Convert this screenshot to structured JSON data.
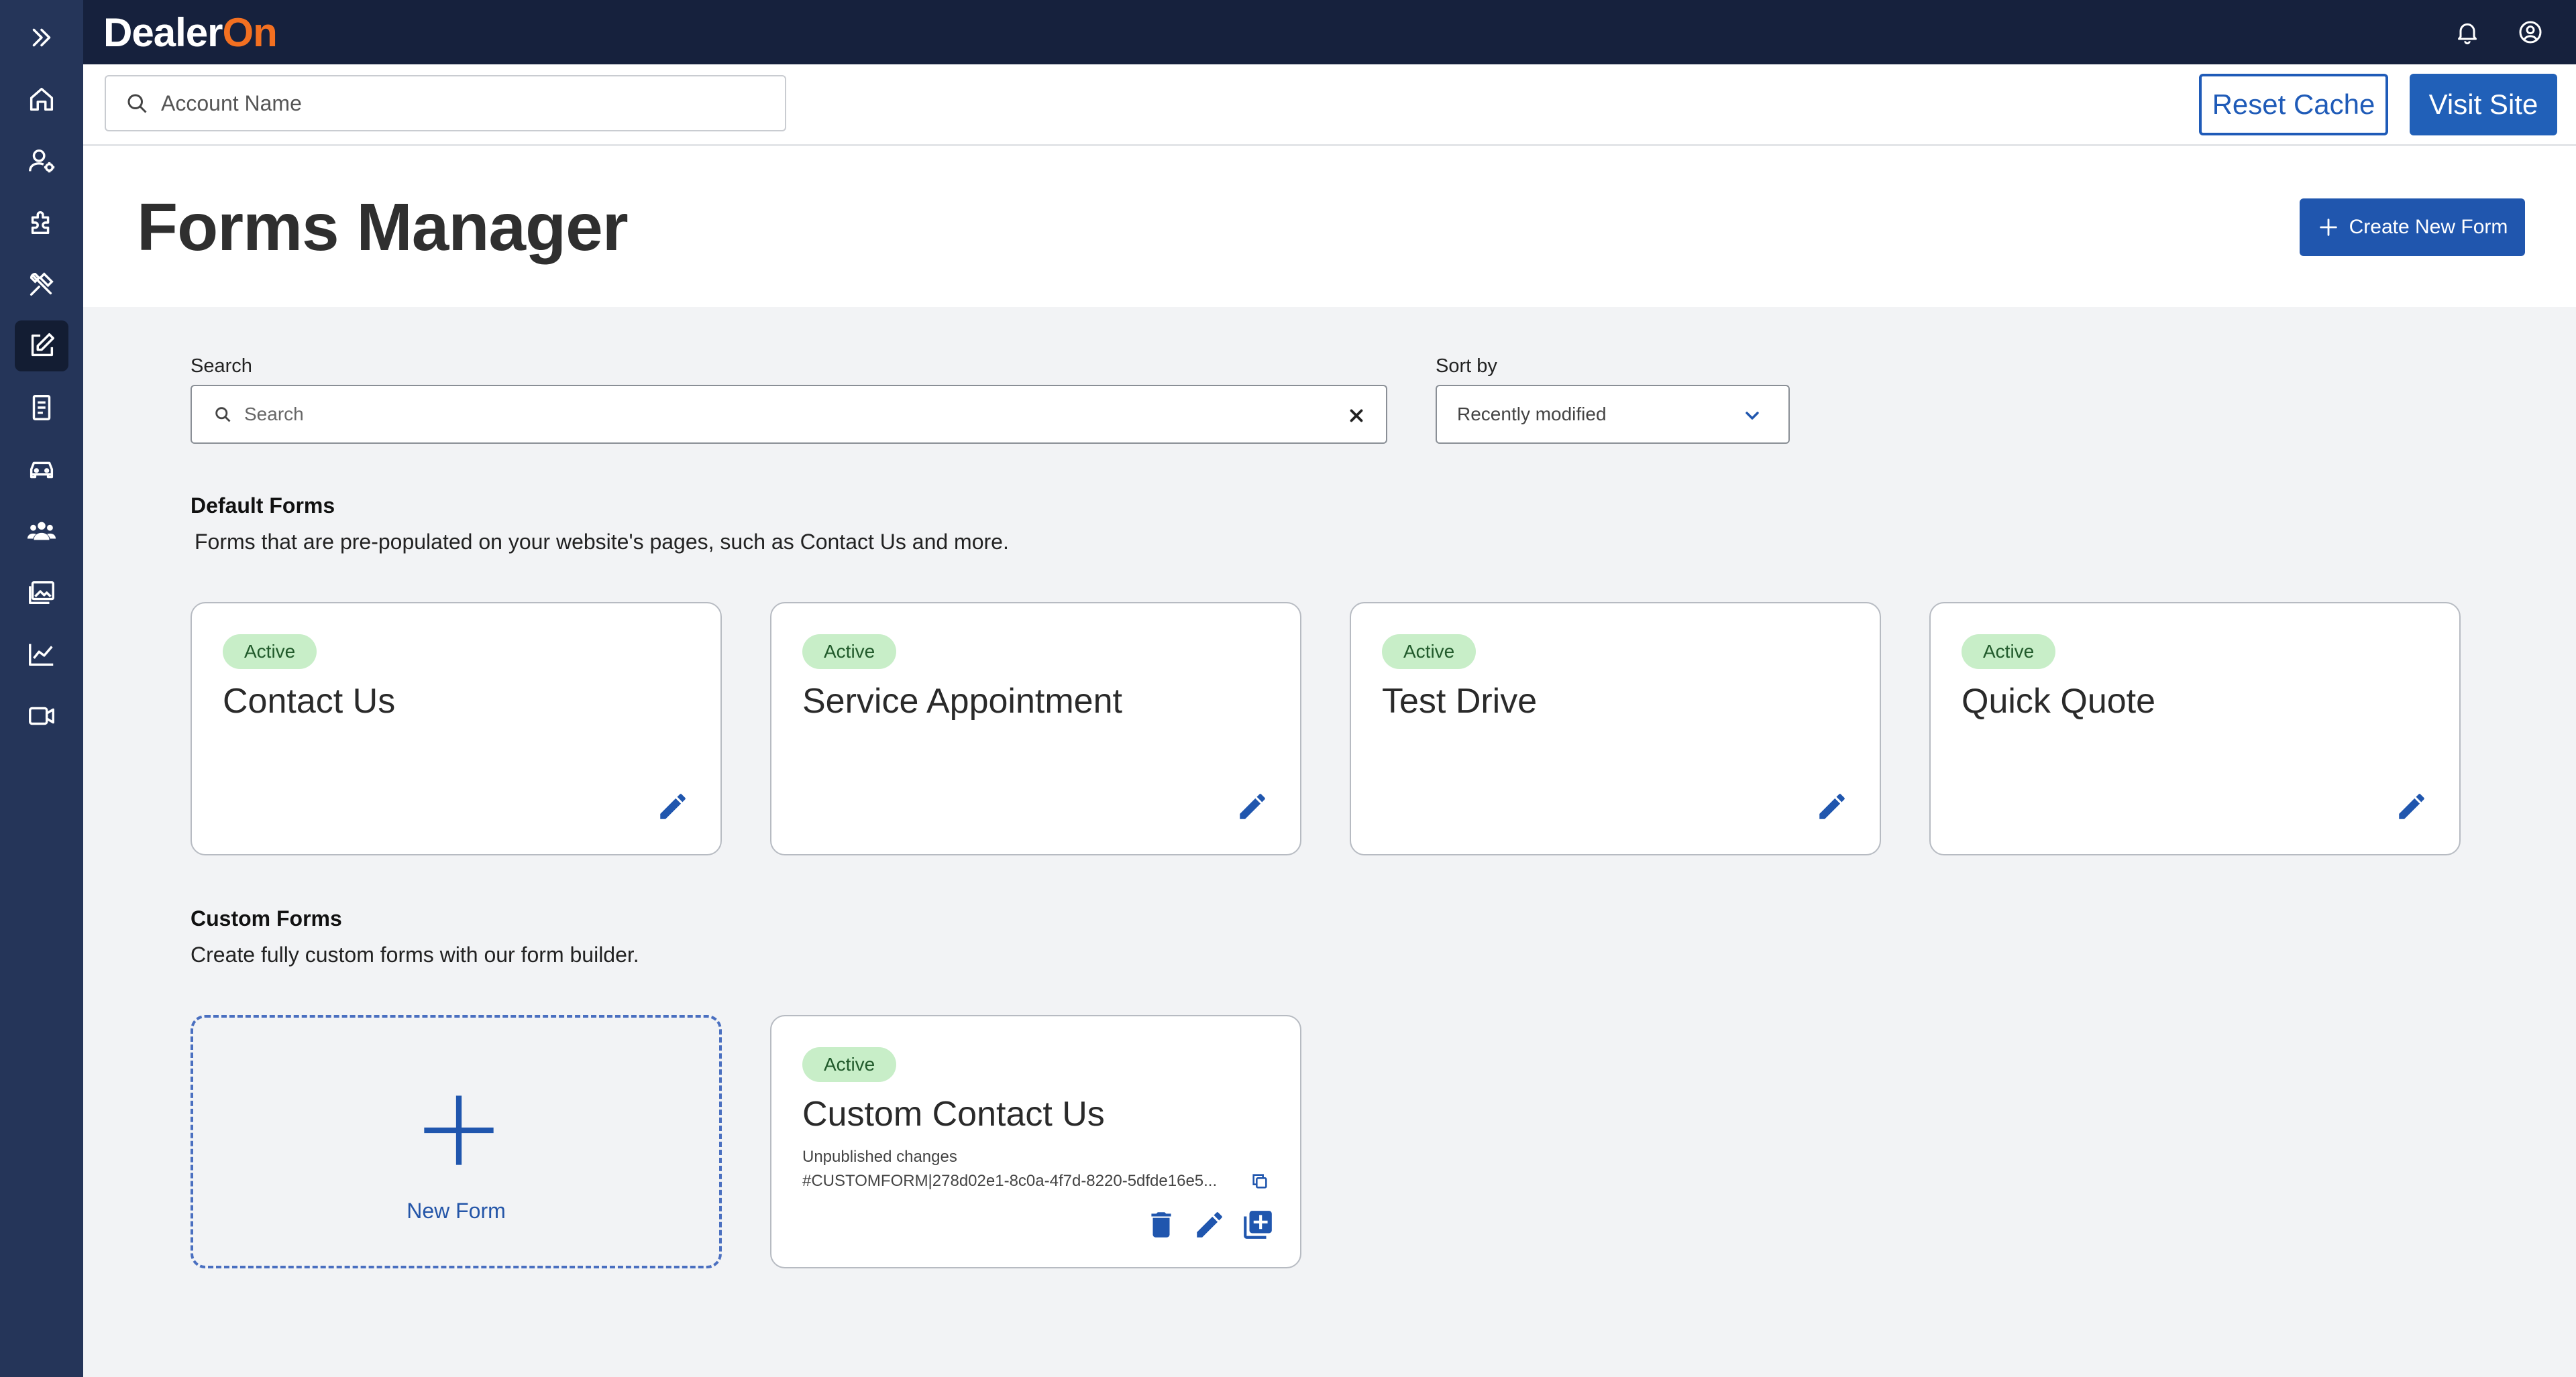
{
  "app": {
    "brand": {
      "part1": "Dealer",
      "part2": "On"
    },
    "colors": {
      "accent": "#2056ae",
      "rail": "#253559",
      "topbar": "#16213d",
      "brand_orange": "#f37021",
      "badge_bg": "#c8eec8",
      "badge_text": "#215a2b"
    }
  },
  "nav": {
    "items": [
      {
        "icon": "expand-icon"
      },
      {
        "icon": "home-icon"
      },
      {
        "icon": "user-settings-icon"
      },
      {
        "icon": "puzzle-icon"
      },
      {
        "icon": "tools-icon"
      },
      {
        "icon": "edit-form-icon",
        "active": true
      },
      {
        "icon": "receipt-icon"
      },
      {
        "icon": "car-icon"
      },
      {
        "icon": "group-icon"
      },
      {
        "icon": "image-gallery-icon"
      },
      {
        "icon": "chart-line-icon"
      },
      {
        "icon": "video-icon"
      }
    ]
  },
  "topbar": {
    "icons": [
      "bell-icon",
      "account-circle-icon"
    ]
  },
  "account_bar": {
    "placeholder": "Account Name",
    "reset_cache": "Reset Cache",
    "visit_site": "Visit Site"
  },
  "header": {
    "title": "Forms Manager",
    "create_button": "Create New Form"
  },
  "filters": {
    "search_label": "Search",
    "search_placeholder": "Search",
    "sort_label": "Sort by",
    "sort_value": "Recently modified"
  },
  "default_forms": {
    "title": "Default Forms",
    "description": "Forms that are pre-populated on your website's pages, such as Contact Us and more.",
    "cards": [
      {
        "status": "Active",
        "name": "Contact Us"
      },
      {
        "status": "Active",
        "name": "Service Appointment"
      },
      {
        "status": "Active",
        "name": "Test Drive"
      },
      {
        "status": "Active",
        "name": "Quick Quote"
      }
    ]
  },
  "custom_forms": {
    "title": "Custom Forms",
    "description": "Create fully custom forms with our form builder.",
    "new_form_label": "New Form",
    "cards": [
      {
        "status": "Active",
        "name": "Custom Contact Us",
        "note": "Unpublished changes",
        "id": "#CUSTOMFORM|278d02e1-8c0a-4f7d-8220-5dfde16e5..."
      }
    ]
  }
}
